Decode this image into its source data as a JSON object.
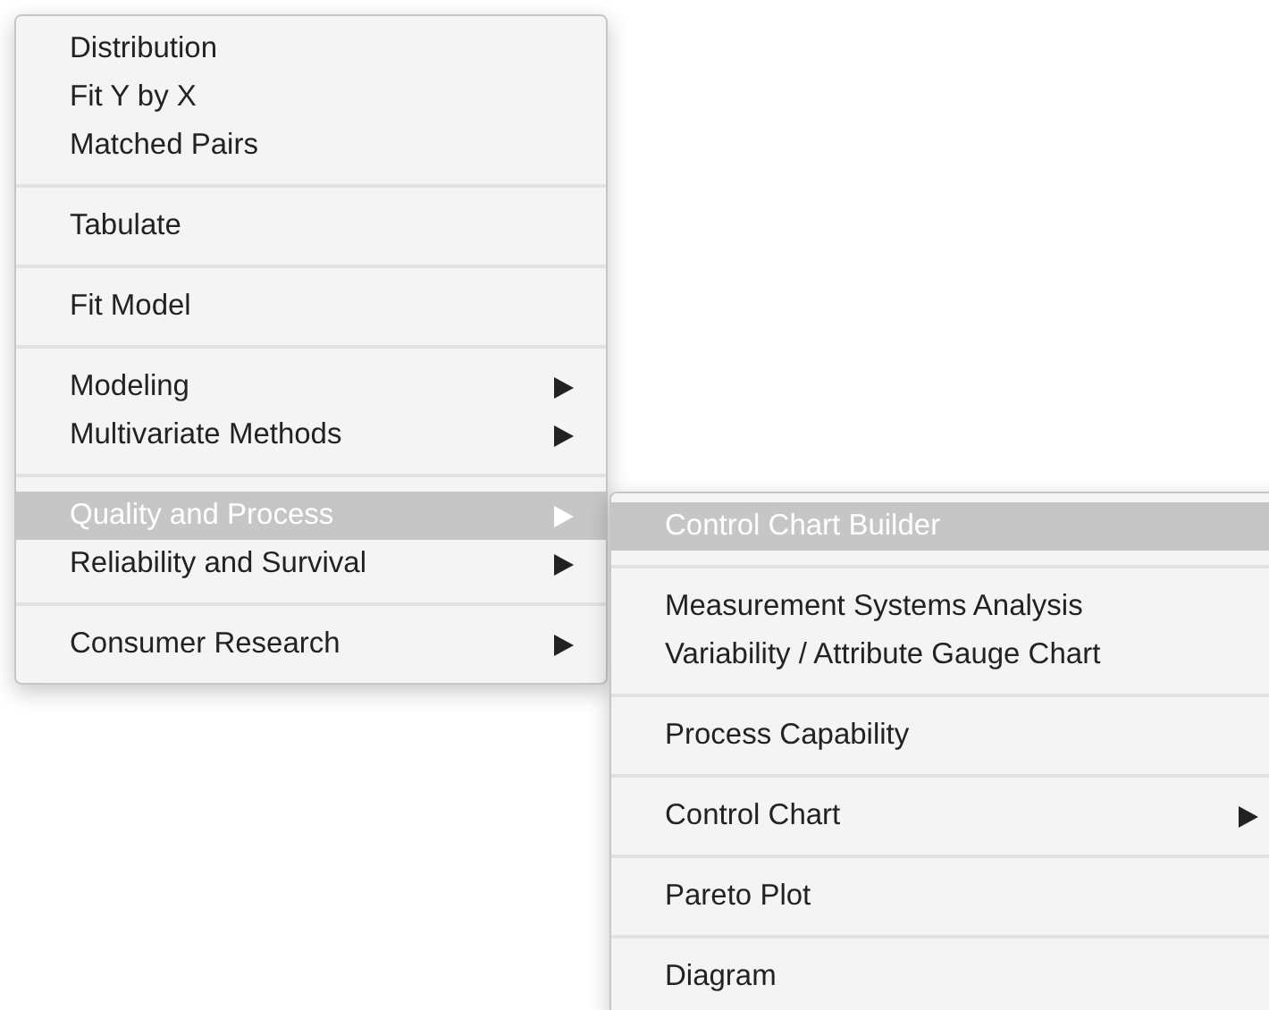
{
  "menu": {
    "groups": [
      {
        "items": [
          {
            "label": "Distribution",
            "has_submenu": false,
            "selected": false
          },
          {
            "label": "Fit Y by X",
            "has_submenu": false,
            "selected": false
          },
          {
            "label": "Matched Pairs",
            "has_submenu": false,
            "selected": false
          }
        ]
      },
      {
        "items": [
          {
            "label": "Tabulate",
            "has_submenu": false,
            "selected": false
          }
        ]
      },
      {
        "items": [
          {
            "label": "Fit Model",
            "has_submenu": false,
            "selected": false
          }
        ]
      },
      {
        "items": [
          {
            "label": "Modeling",
            "has_submenu": true,
            "selected": false
          },
          {
            "label": "Multivariate Methods",
            "has_submenu": true,
            "selected": false
          }
        ]
      },
      {
        "items": [
          {
            "label": "Quality and Process",
            "has_submenu": true,
            "selected": true
          },
          {
            "label": "Reliability and Survival",
            "has_submenu": true,
            "selected": false
          }
        ]
      },
      {
        "items": [
          {
            "label": "Consumer Research",
            "has_submenu": true,
            "selected": false
          }
        ]
      }
    ]
  },
  "submenu": {
    "groups": [
      {
        "items": [
          {
            "label": "Control Chart Builder",
            "has_submenu": false,
            "selected": true
          }
        ]
      },
      {
        "items": [
          {
            "label": "Measurement Systems Analysis",
            "has_submenu": false,
            "selected": false
          },
          {
            "label": "Variability / Attribute Gauge Chart",
            "has_submenu": false,
            "selected": false
          }
        ]
      },
      {
        "items": [
          {
            "label": "Process Capability",
            "has_submenu": false,
            "selected": false
          }
        ]
      },
      {
        "items": [
          {
            "label": "Control Chart",
            "has_submenu": true,
            "selected": false
          }
        ]
      },
      {
        "items": [
          {
            "label": "Pareto Plot",
            "has_submenu": false,
            "selected": false
          }
        ]
      },
      {
        "items": [
          {
            "label": "Diagram",
            "has_submenu": false,
            "selected": false
          }
        ]
      }
    ]
  }
}
